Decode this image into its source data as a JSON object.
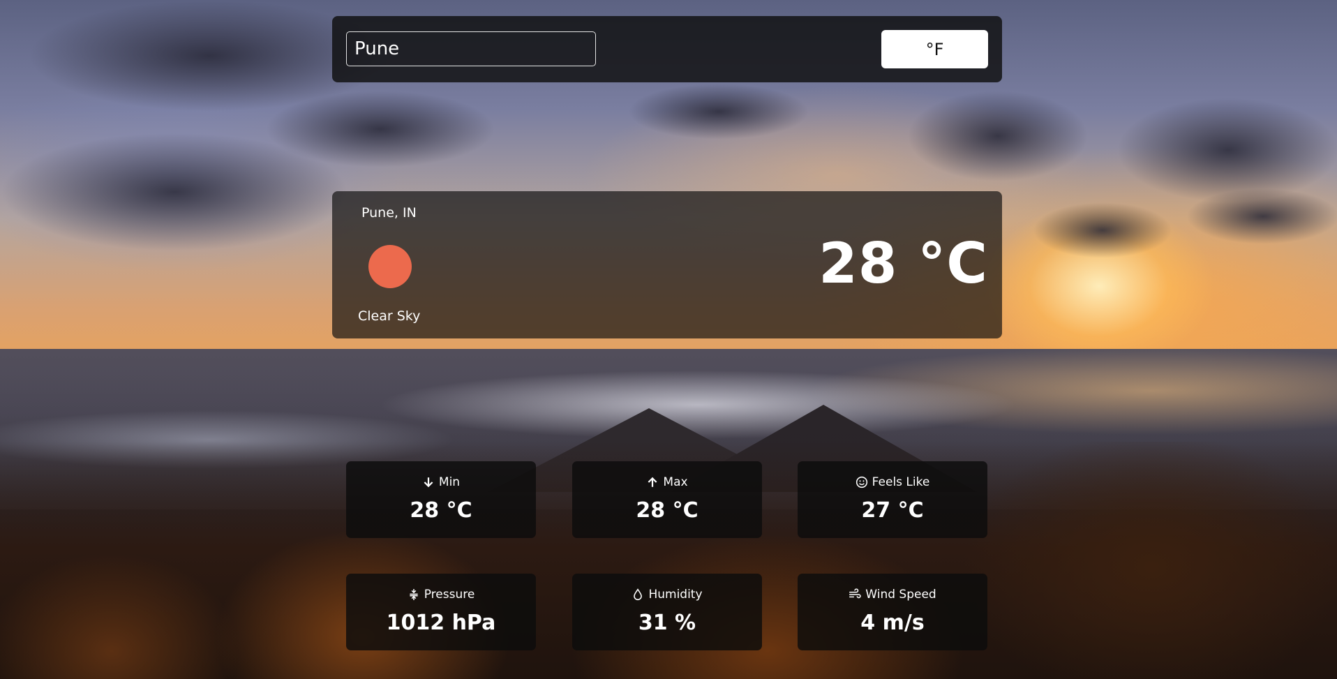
{
  "search": {
    "value": "Pune"
  },
  "unit_toggle": {
    "label": "°F"
  },
  "current": {
    "location": "Pune, IN",
    "condition": "Clear Sky",
    "temperature": "28 °C",
    "icon": "sun-icon",
    "icon_color": "#ec6a4d"
  },
  "stats": {
    "min": {
      "label": "Min",
      "value": "28 °C",
      "icon": "arrow-down-icon"
    },
    "max": {
      "label": "Max",
      "value": "28 °C",
      "icon": "arrow-up-icon"
    },
    "feels_like": {
      "label": "Feels Like",
      "value": "27 °C",
      "icon": "smile-icon"
    },
    "pressure": {
      "label": "Pressure",
      "value": "1012 hPa",
      "icon": "compress-icon"
    },
    "humidity": {
      "label": "Humidity",
      "value": "31 %",
      "icon": "droplet-icon"
    },
    "wind_speed": {
      "label": "Wind Speed",
      "value": "4 m/s",
      "icon": "wind-icon"
    }
  }
}
